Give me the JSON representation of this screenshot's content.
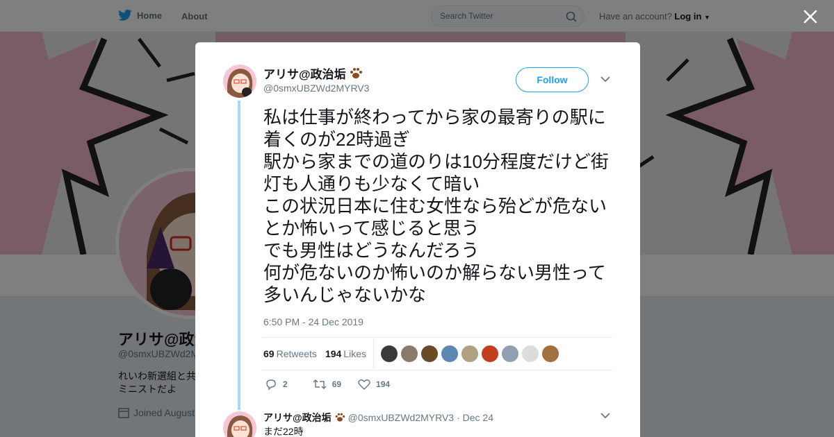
{
  "nav": {
    "home_label": "Home",
    "about_label": "About",
    "search_placeholder": "Search Twitter",
    "account_prompt": "Have an account?",
    "login_label": "Log in"
  },
  "profile": {
    "name": "アリサ@政治",
    "handle": "@0smxUBZWd2M",
    "bio": "れいわ新選組と共 ミニストだよ",
    "joined": "Joined August"
  },
  "tweet": {
    "name": "アリサ@政治垢",
    "handle": "@0smxUBZWd2MYRV3",
    "follow_label": "Follow",
    "text": "私は仕事が終わってから家の最寄りの駅に着くのが22時過ぎ\n駅から家までの道のりは10分程度だけど街灯も人通りも少なくて暗い\nこの状況日本に住む女性なら殆どが危ないとか怖いって感じると思う\nでも男性はどうなんだろう\n何が危ないのか怖いのか解らない男性って多いんじゃないかな",
    "timestamp": "6:50 PM - 24 Dec 2019",
    "retweets_count": "69",
    "retweets_label": "Retweets",
    "likes_count": "194",
    "likes_label": "Likes",
    "reply_count": "2",
    "retweet_action_count": "69",
    "like_action_count": "194"
  },
  "reply": {
    "name": "アリサ@政治垢",
    "handle": "@0smxUBZWd2MYRV3",
    "date": "· Dec 24",
    "text": "まだ22時"
  },
  "liker_colors": [
    "#3a3a3a",
    "#8a7a6a",
    "#6b4a2a",
    "#5a88b0",
    "#b0a080",
    "#c04020",
    "#90a0b0",
    "#dcdcdc",
    "#a07040"
  ],
  "colors": {
    "accent": "#1da1f2",
    "thread": "#a4d9f9"
  }
}
